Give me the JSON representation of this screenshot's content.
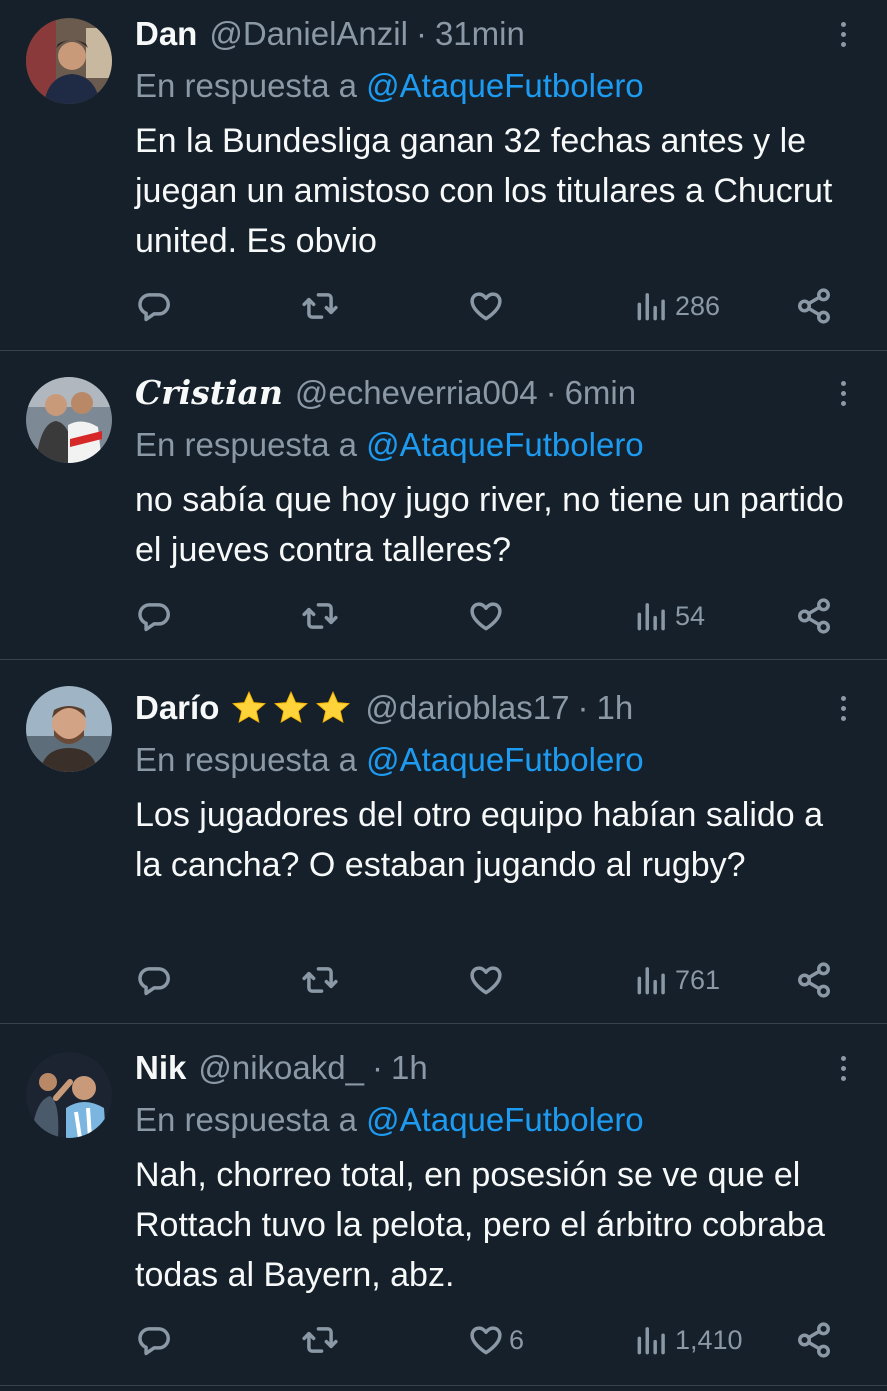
{
  "tweets": [
    {
      "name": "Dan",
      "handle": "@DanielAnzil",
      "sep": "·",
      "time": "31min",
      "reply_prefix": "En respuesta a",
      "reply_to": "@AtaqueFutbolero",
      "text": "En la Bundesliga ganan 32 fechas antes y le juegan un amistoso con los titulares a Chucrut united. Es obvio",
      "likes": "",
      "views": "286"
    },
    {
      "name": "Cristian",
      "handle": "@echeverria004",
      "sep": "·",
      "time": "6min",
      "reply_prefix": "En respuesta a",
      "reply_to": "@AtaqueFutbolero",
      "text": "no sabía que hoy jugo river, no tiene un partido el jueves contra talleres?",
      "likes": "",
      "views": "54"
    },
    {
      "name": "Darío",
      "handle": "@darioblas17",
      "sep": "·",
      "time": "1h",
      "reply_prefix": "En respuesta a",
      "reply_to": "@AtaqueFutbolero",
      "text": "Los jugadores del otro equipo habían salido a la cancha? O estaban jugando al rugby?",
      "likes": "",
      "views": "761"
    },
    {
      "name": "Nik",
      "handle": "@nikoakd_",
      "sep": "·",
      "time": "1h",
      "reply_prefix": "En respuesta a",
      "reply_to": "@AtaqueFutbolero",
      "text": "Nah, chorreo total, en posesión se ve que el Rottach tuvo la pelota, pero el árbitro cobraba todas al Bayern, abz.",
      "likes": "6",
      "views": "1,410"
    }
  ],
  "colors": {
    "background": "#15202b",
    "text": "#f7f9f9",
    "muted": "#8b98a5",
    "accent": "#1d9bf0",
    "star": "#ffd43b",
    "divider": "#38444d"
  },
  "icons": [
    "more-icon",
    "reply-icon",
    "retweet-icon",
    "like-icon",
    "views-icon",
    "share-icon",
    "star-icon"
  ]
}
